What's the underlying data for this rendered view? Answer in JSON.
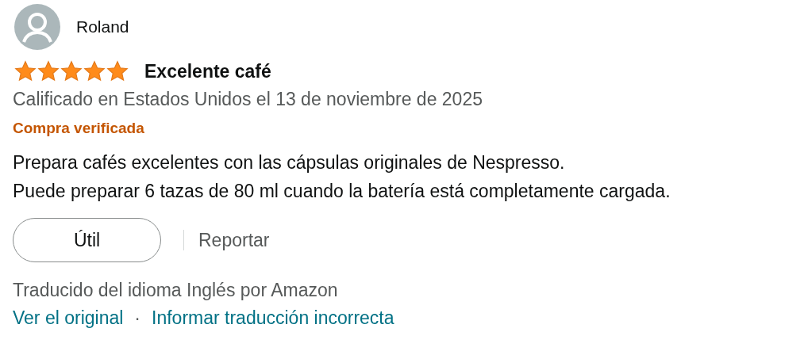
{
  "review": {
    "author": "Roland",
    "stars": 5,
    "title": "Excelente café",
    "date": "Calificado en Estados Unidos el 13 de noviembre de 2025",
    "badge": "Compra verificada",
    "body": [
      "Prepara cafés excelentes con las cápsulas originales de Nespresso.",
      "Puede preparar 6 tazas de 80 ml cuando la batería está completamente cargada."
    ],
    "actions": {
      "helpful": "Útil",
      "report": "Reportar"
    },
    "translation": {
      "note": "Traducido del idioma Inglés por Amazon",
      "links": [
        "Ver el original",
        "Informar traducción incorrecta"
      ],
      "separator": "·"
    }
  }
}
